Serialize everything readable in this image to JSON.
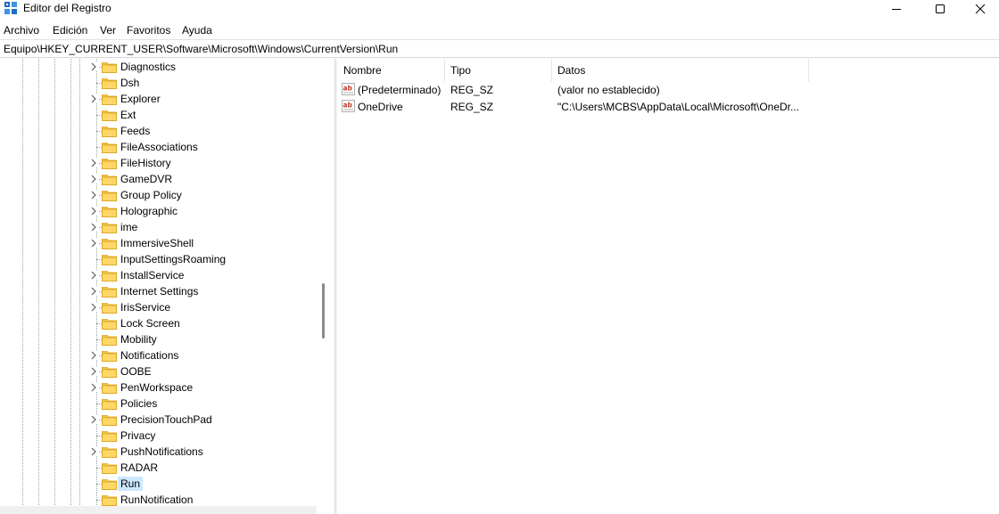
{
  "window": {
    "title": "Editor del Registro",
    "minimize_icon": "minimize-icon",
    "maximize_icon": "maximize-icon",
    "close_icon": "close-icon"
  },
  "menu": [
    "Archivo",
    "Edición",
    "Ver",
    "Favoritos",
    "Ayuda"
  ],
  "address": "Equipo\\HKEY_CURRENT_USER\\Software\\Microsoft\\Windows\\CurrentVersion\\Run",
  "tree": {
    "items": [
      {
        "label": "Diagnostics",
        "expandable": true
      },
      {
        "label": "Dsh",
        "expandable": false
      },
      {
        "label": "Explorer",
        "expandable": true
      },
      {
        "label": "Ext",
        "expandable": false
      },
      {
        "label": "Feeds",
        "expandable": false
      },
      {
        "label": "FileAssociations",
        "expandable": false
      },
      {
        "label": "FileHistory",
        "expandable": true
      },
      {
        "label": "GameDVR",
        "expandable": true
      },
      {
        "label": "Group Policy",
        "expandable": true
      },
      {
        "label": "Holographic",
        "expandable": true
      },
      {
        "label": "ime",
        "expandable": true
      },
      {
        "label": "ImmersiveShell",
        "expandable": true
      },
      {
        "label": "InputSettingsRoaming",
        "expandable": false
      },
      {
        "label": "InstallService",
        "expandable": true
      },
      {
        "label": "Internet Settings",
        "expandable": true
      },
      {
        "label": "IrisService",
        "expandable": true
      },
      {
        "label": "Lock Screen",
        "expandable": false
      },
      {
        "label": "Mobility",
        "expandable": false
      },
      {
        "label": "Notifications",
        "expandable": true
      },
      {
        "label": "OOBE",
        "expandable": true
      },
      {
        "label": "PenWorkspace",
        "expandable": true
      },
      {
        "label": "Policies",
        "expandable": false
      },
      {
        "label": "PrecisionTouchPad",
        "expandable": true
      },
      {
        "label": "Privacy",
        "expandable": false
      },
      {
        "label": "PushNotifications",
        "expandable": true
      },
      {
        "label": "RADAR",
        "expandable": false
      },
      {
        "label": "Run",
        "expandable": false,
        "selected": true
      },
      {
        "label": "RunNotification",
        "expandable": false
      }
    ]
  },
  "list": {
    "columns": [
      "Nombre",
      "Tipo",
      "Datos"
    ],
    "rows": [
      {
        "name": "(Predeterminado)",
        "type": "REG_SZ",
        "data": "(valor no establecido)",
        "icon": "string-value-icon"
      },
      {
        "name": "OneDrive",
        "type": "REG_SZ",
        "data": "\"C:\\Users\\MCBS\\AppData\\Local\\Microsoft\\OneDr...",
        "icon": "string-value-icon"
      }
    ]
  },
  "colors": {
    "selection": "#cce8ff",
    "folder": "#f5c542",
    "ab_icon": "#c0392b"
  }
}
